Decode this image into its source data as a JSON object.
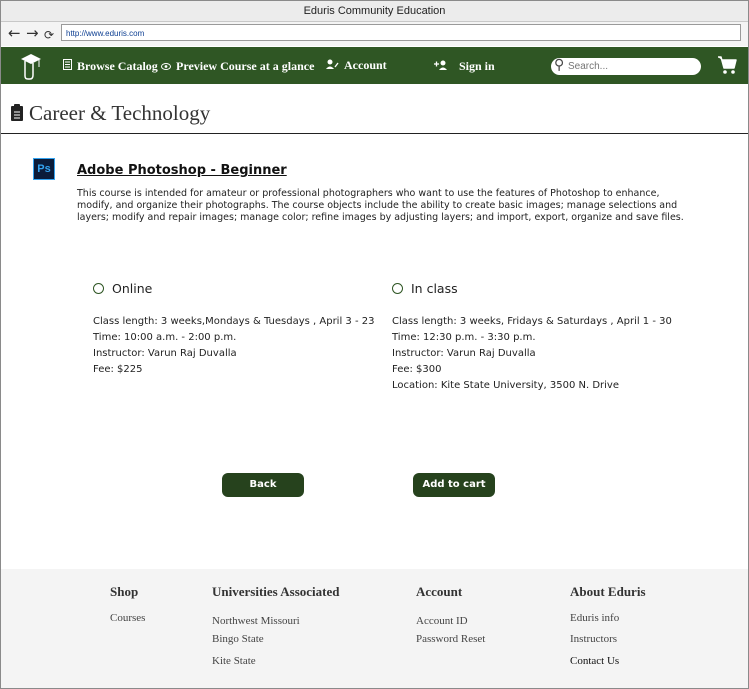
{
  "window": {
    "title": "Eduris Community Education"
  },
  "browser": {
    "back_glyph": "←",
    "forward_glyph": "→",
    "reload_glyph": "⟳",
    "url": "http://www.eduris.com"
  },
  "nav": {
    "browse_label": "Browse Catalog",
    "preview_label": "Preview Course at a glance",
    "account_label": "Account",
    "signin_label": "Sign in",
    "search_placeholder": "Search..."
  },
  "category": {
    "title": "Career & Technology"
  },
  "course": {
    "icon_text": "Ps",
    "title": "Adobe Photoshop - Beginner",
    "description": "This course is intended for amateur or professional photographers who want to use the features of Photoshop to enhance, modify, and organize their photographs. The course objects include the ability to create basic images; manage selections and layers; modify and repair images; manage color; refine images by adjusting layers; and import, export, organize and save files."
  },
  "options": {
    "online": {
      "label": "Online",
      "length": "Class length: 3 weeks,Mondays & Tuesdays , April 3 -  23",
      "time": "Time: 10:00 a.m. - 2:00 p.m.",
      "instructor": "Instructor: Varun Raj Duvalla",
      "fee": "Fee: $225"
    },
    "inclass": {
      "label": "In class",
      "length": "Class length: 3 weeks, Fridays & Saturdays , April 1 - 30",
      "time": "Time: 12:30 p.m. - 3:30 p.m.",
      "instructor": "Instructor: Varun Raj Duvalla",
      "fee": "Fee: $300",
      "location": "Location: Kite State University, 3500 N. Drive"
    }
  },
  "buttons": {
    "back": "Back",
    "add_to_cart": "Add to cart"
  },
  "footer": {
    "shop": {
      "heading": "Shop",
      "links": [
        "Courses"
      ]
    },
    "universities": {
      "heading": "Universities Associated",
      "links": [
        "Northwest Missouri",
        "Bingo State",
        "Kite State"
      ]
    },
    "account": {
      "heading": "Account",
      "links": [
        "Account ID",
        "Password Reset"
      ]
    },
    "about": {
      "heading": "About Eduris",
      "links": [
        "Eduris info",
        "Instructors",
        "Contact Us"
      ]
    }
  },
  "colors": {
    "nav_green": "#2f5624",
    "button_green": "#26421d"
  }
}
